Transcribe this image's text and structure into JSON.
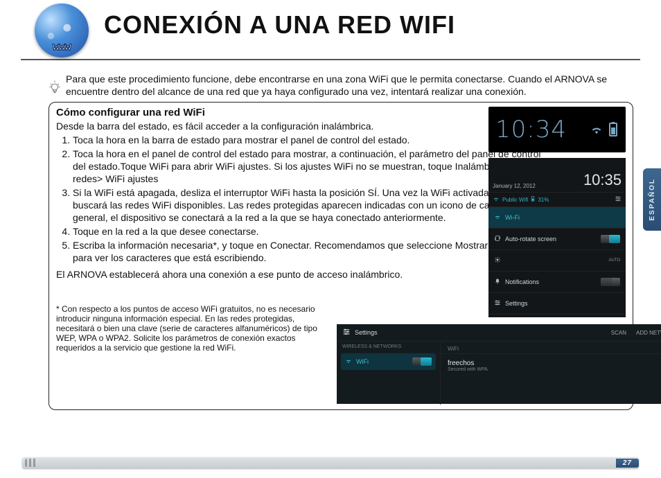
{
  "header": {
    "globe_label": "www",
    "title": "CONEXIÓN A UNA RED WIFI"
  },
  "intro": "Para que este procedimiento funcione, debe encontrarse en una zona WiFi que le permita conectarse. Cuando el ARNOVA se encuentre dentro del alcance de una red que ya haya configurado una vez, intentará realizar una conexión.",
  "box": {
    "heading": "Cómo configurar una red WiFi",
    "lead": "Desde la barra del estado, es fácil acceder a la configuración inalámbrica.",
    "steps": [
      "Toca la hora en la barra de estado para mostrar el panel de control del estado.",
      "Toca la hora en el panel de control del estado para mostrar, a continuación, el parámetro del panel de control del estado.Toque WiFi para abrir WiFi ajustes. Si los ajustes WiFi no se muestran, toque Inalámbrico y redes> WiFi ajustes",
      "Si la WiFi está apagada, desliza el interruptor WiFi hasta la posición SÍ. Una vez la WiFi activada, ARNOVA buscará las redes WiFi disponibles. Las redes protegidas aparecen indicadas con un icono de candado. En general, el dispositivo se conectará a la red a la que se haya conectado anteriormente.",
      "Toque en la red a la que desee conectarse.",
      "Escriba la información necesaria*, y toque en Conectar. Recomendamos que seleccione Mostrar contraseña para ver los caracteres que está escribiendo."
    ],
    "after": "El ARNOVA establecerá ahora una conexión a ese punto de acceso inalámbrico.",
    "footnote": "* Con respecto a los puntos de acceso WiFi gratuitos, no es necesario introducir ninguna información especial. En las redes protegidas, necesitará o bien una clave (serie de caracteres alfanuméricos) de tipo WEP, WPA o WPA2.  Solicite los parámetros de conexión exactos requeridos a la servicio que gestione la red WiFi."
  },
  "clock_shot": {
    "time": "10:34"
  },
  "panel_shot": {
    "date": "January 12, 2012",
    "time": "10:35",
    "network_name": "Public Wifi",
    "battery_pct": "31%",
    "rows": {
      "wifi": "Wi-Fi",
      "autorotate": "Auto-rotate screen",
      "autorotate_state": "ON",
      "brightness_mode": "AUTO",
      "notifications": "Notifications",
      "notifications_state": "OFF",
      "settings": "Settings"
    }
  },
  "wifi_shot": {
    "title": "Settings",
    "actions": {
      "scan": "SCAN",
      "add": "ADD NETWORK"
    },
    "category": "WIRELESS & NETWORKS",
    "item": "WiFi",
    "item_state": "ON",
    "list_header": "WiFi",
    "network": {
      "name": "freechos",
      "sub": "Secured with WPA"
    }
  },
  "side_tab": "ESPAÑOL",
  "page_number": "27"
}
